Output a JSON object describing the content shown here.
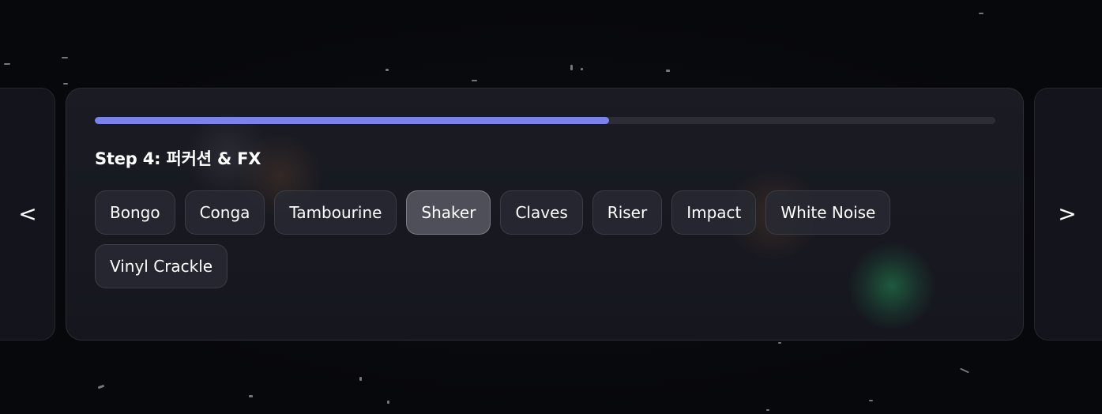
{
  "navigation": {
    "prev_label": "<",
    "next_label": ">"
  },
  "progress": {
    "fraction": 0.571,
    "color": "#7b83eb"
  },
  "step": {
    "title": "Step 4: 퍼커션 & FX"
  },
  "options": [
    {
      "label": "Bongo",
      "selected": false
    },
    {
      "label": "Conga",
      "selected": false
    },
    {
      "label": "Tambourine",
      "selected": false
    },
    {
      "label": "Shaker",
      "selected": true
    },
    {
      "label": "Claves",
      "selected": false
    },
    {
      "label": "Riser",
      "selected": false
    },
    {
      "label": "Impact",
      "selected": false
    },
    {
      "label": "White Noise",
      "selected": false
    },
    {
      "label": "Vinyl Crackle",
      "selected": false
    }
  ]
}
